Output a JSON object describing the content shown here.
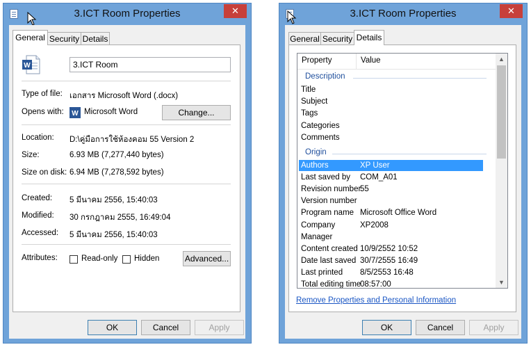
{
  "general_window": {
    "title": "3.ICT Room Properties",
    "close_label": "✕",
    "tabs": [
      "General",
      "Security",
      "Details"
    ],
    "file_name": "3.ICT Room",
    "type_label": "Type of file:",
    "type_value": "เอกสาร Microsoft Word (.docx)",
    "opens_label": "Opens with:",
    "opens_value": "Microsoft Word",
    "change_label": "Change...",
    "location_label": "Location:",
    "location_value": "D:\\คู่มือการใช้ห้องคอม 55 Version 2",
    "size_label": "Size:",
    "size_value": "6.93 MB (7,277,440 bytes)",
    "size_disk_label": "Size on disk:",
    "size_disk_value": "6.94 MB (7,278,592 bytes)",
    "created_label": "Created:",
    "created_value": "5 มีนาคม 2556, 15:40:03",
    "modified_label": "Modified:",
    "modified_value": "30 กรกฎาคม 2555, 16:49:04",
    "accessed_label": "Accessed:",
    "accessed_value": "5 มีนาคม 2556, 15:40:03",
    "attributes_label": "Attributes:",
    "readonly_label": "Read-only",
    "hidden_label": "Hidden",
    "advanced_label": "Advanced...",
    "ok_label": "OK",
    "cancel_label": "Cancel",
    "apply_label": "Apply"
  },
  "details_window": {
    "title": "3.ICT Room Properties",
    "close_label": "✕",
    "tabs": [
      "General",
      "Security",
      "Details"
    ],
    "col_property": "Property",
    "col_value": "Value",
    "group_description": "Description",
    "description_rows": [
      {
        "p": "Title",
        "v": ""
      },
      {
        "p": "Subject",
        "v": ""
      },
      {
        "p": "Tags",
        "v": ""
      },
      {
        "p": "Categories",
        "v": ""
      },
      {
        "p": "Comments",
        "v": ""
      }
    ],
    "group_origin": "Origin",
    "origin_rows": [
      {
        "p": "Authors",
        "v": "XP User"
      },
      {
        "p": "Last saved by",
        "v": "COM_A01"
      },
      {
        "p": "Revision number",
        "v": "55"
      },
      {
        "p": "Version number",
        "v": ""
      },
      {
        "p": "Program name",
        "v": "Microsoft Office Word"
      },
      {
        "p": "Company",
        "v": "XP2008"
      },
      {
        "p": "Manager",
        "v": ""
      },
      {
        "p": "Content created",
        "v": "10/9/2552 10:52"
      },
      {
        "p": "Date last saved",
        "v": "30/7/2555 16:49"
      },
      {
        "p": "Last printed",
        "v": "8/5/2553 16:48"
      },
      {
        "p": "Total editing time",
        "v": "08:57:00"
      }
    ],
    "selected_row": "Authors",
    "remove_link": "Remove Properties and Personal Information",
    "ok_label": "OK",
    "cancel_label": "Cancel",
    "apply_label": "Apply"
  },
  "colors": {
    "frame": "#6fa3d9",
    "close": "#c7403a",
    "selection": "#3399ff",
    "group_text": "#1e4e9c",
    "link": "#1a56c4"
  },
  "icons": [
    "app-icon",
    "cursor-icon",
    "word-document-icon",
    "word-app-icon",
    "scroll-up-icon",
    "scroll-down-icon"
  ]
}
